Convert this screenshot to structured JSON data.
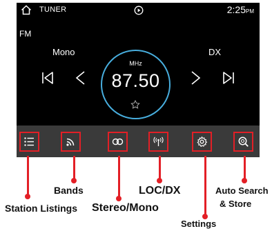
{
  "status_bar": {
    "source_title": "TUNER",
    "time": "2:25",
    "ampm": "PM"
  },
  "band": "FM",
  "modes": {
    "left": "Mono",
    "right": "DX"
  },
  "tuner": {
    "unit": "MHz",
    "frequency": "87.50",
    "favorite": false
  },
  "icons": {
    "home": "home-icon",
    "media": "media-icon",
    "prev_preset": "skip-previous-icon",
    "seek_down": "chevron-left-icon",
    "seek_up": "chevron-right-icon",
    "next_preset": "skip-next-icon",
    "favorite": "star-outline-icon"
  },
  "buttons": [
    {
      "id": "station-list",
      "icon": "list-icon"
    },
    {
      "id": "bands",
      "icon": "bands-icon"
    },
    {
      "id": "stereo-mono",
      "icon": "stereo-icon"
    },
    {
      "id": "loc-dx",
      "icon": "antenna-icon"
    },
    {
      "id": "settings",
      "icon": "gear-icon"
    },
    {
      "id": "auto-search",
      "icon": "search-icon"
    }
  ],
  "callouts": {
    "station_listings": "Station Listings",
    "bands": "Bands",
    "stereo_mono": "Stereo/Mono",
    "loc_dx": "LOC/DX",
    "settings": "Settings",
    "auto_search_line1": "Auto Search",
    "auto_search_line2": "& Store"
  },
  "colors": {
    "accent_ring": "#48aede",
    "callout_red": "#e31f26",
    "bar": "#3a3a3a",
    "screen": "#000000"
  }
}
